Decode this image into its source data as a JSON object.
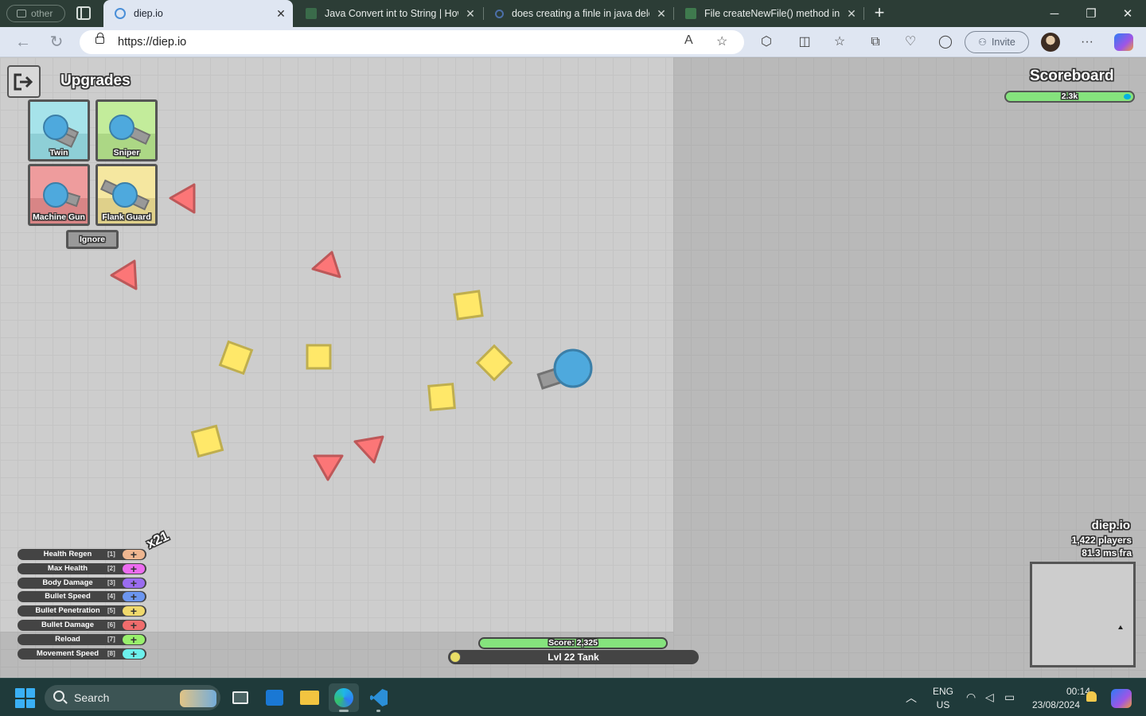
{
  "browser": {
    "profile_label": "other",
    "tabs": [
      {
        "title": "diep.io",
        "active": true
      },
      {
        "title": "Java Convert int to String | How t",
        "active": false
      },
      {
        "title": "does creating a finle in java delet",
        "active": false
      },
      {
        "title": "File createNewFile() method in Ja",
        "active": false
      }
    ],
    "url": "https://diep.io",
    "invite_label": "Invite",
    "window_controls": [
      "minimize",
      "restore",
      "close"
    ]
  },
  "game": {
    "upgrades_title": "Upgrades",
    "upgrade_options": [
      {
        "label": "Twin",
        "top_color": "#a6e3ea",
        "bottom_color": "#8ecfd6"
      },
      {
        "label": "Sniper",
        "top_color": "#c3ec9b",
        "bottom_color": "#acd785"
      },
      {
        "label": "Machine Gun",
        "top_color": "#ee9c9d",
        "bottom_color": "#d88586"
      },
      {
        "label": "Flank Guard",
        "top_color": "#f5e7a0",
        "bottom_color": "#dfd08a"
      }
    ],
    "ignore_label": "Ignore",
    "scoreboard": {
      "title": "Scoreboard",
      "entry_label": "2.3k"
    },
    "server": {
      "name": "diep.io",
      "players": "1,422 players",
      "ms": "81.3 ms fra"
    },
    "stat_points_label": "x21",
    "stats": [
      {
        "name": "Health Regen",
        "key": "[1]",
        "color": "#eeb690"
      },
      {
        "name": "Max Health",
        "key": "[2]",
        "color": "#ec6cf0"
      },
      {
        "name": "Body Damage",
        "key": "[3]",
        "color": "#9a6cf0"
      },
      {
        "name": "Bullet Speed",
        "key": "[4]",
        "color": "#6c96f0"
      },
      {
        "name": "Bullet Penetration",
        "key": "[5]",
        "color": "#f0d96c"
      },
      {
        "name": "Bullet Damage",
        "key": "[6]",
        "color": "#f06c6c"
      },
      {
        "name": "Reload",
        "key": "[7]",
        "color": "#98f06c"
      },
      {
        "name": "Movement Speed",
        "key": "[8]",
        "color": "#6cf0ec"
      }
    ],
    "score_label": "Score: 2,325",
    "level_label": "Lvl 22 Tank",
    "colors": {
      "player": "#00b2e1",
      "square": "#ffe869",
      "triangle": "#fc7677",
      "barrel": "#999999"
    }
  },
  "taskbar": {
    "search_label": "Search",
    "lang_top": "ENG",
    "lang_bottom": "US",
    "time": "00:14",
    "date": "23/08/2024"
  }
}
